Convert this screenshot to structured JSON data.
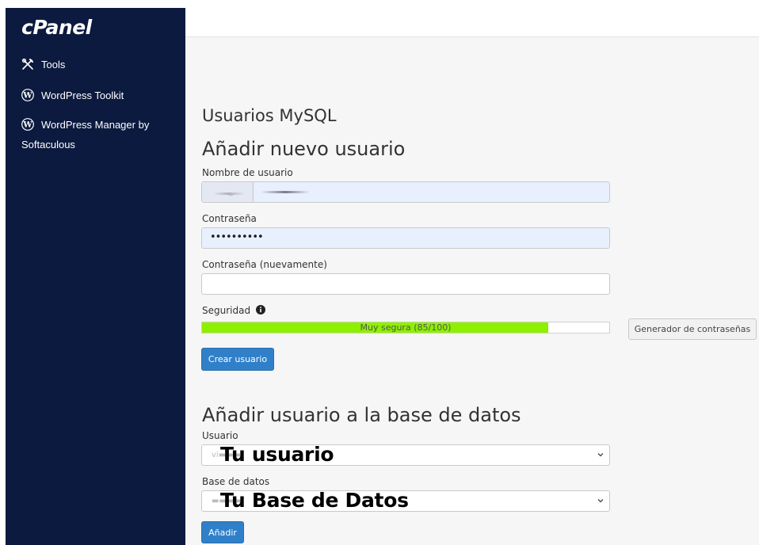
{
  "sidebar": {
    "logo": "cPanel",
    "items": [
      {
        "label": "Tools",
        "icon": "tools-icon"
      },
      {
        "label": "WordPress Toolkit",
        "icon": "wordpress-icon"
      },
      {
        "label": "WordPress Manager by",
        "label_cont": "Softaculous",
        "icon": "wordpress-icon"
      }
    ]
  },
  "main": {
    "page_title": "Usuarios MySQL",
    "add_user": {
      "heading": "Añadir nuevo usuario",
      "username_label": "Nombre de usuario",
      "username_prefix": "_",
      "password_label": "Contraseña",
      "password_value": "••••••••••",
      "password_again_label": "Contraseña (nuevamente)",
      "password_again_value": "",
      "security_label": "Seguridad",
      "strength_text": "Muy segura (85/100)",
      "strength_score": 85,
      "generator_button": "Generador de contraseñas",
      "create_button": "Crear usuario"
    },
    "add_to_db": {
      "heading": "Añadir usuario a la base de datos",
      "user_label": "Usuario",
      "user_overlay": "Tu usuario",
      "db_label": "Base de datos",
      "db_overlay": "Tu Base de Datos",
      "add_button": "Añadir"
    }
  },
  "colors": {
    "sidebar_bg": "#0c1a3f",
    "primary": "#2f80c9",
    "strength": "#8ef000"
  }
}
